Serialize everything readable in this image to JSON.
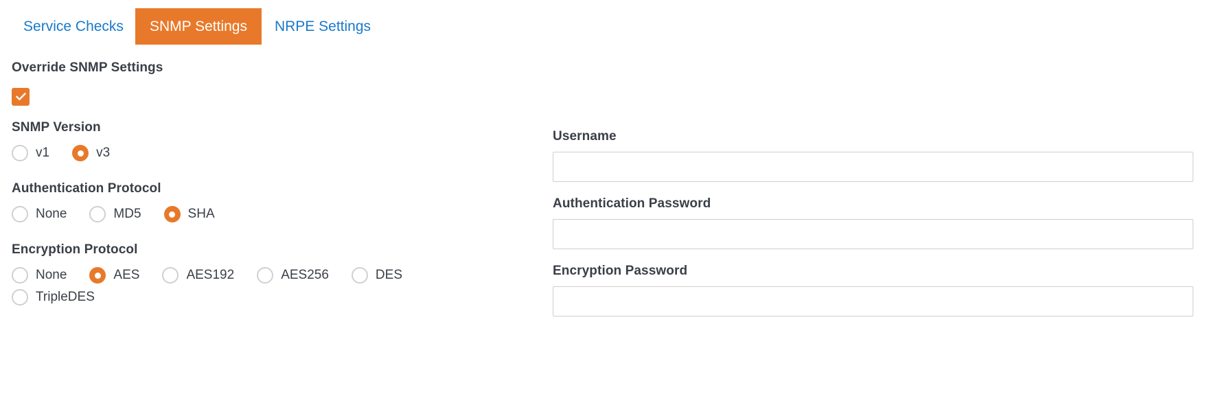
{
  "tabs": [
    {
      "label": "Service Checks",
      "active": false
    },
    {
      "label": "SNMP Settings",
      "active": true
    },
    {
      "label": "NRPE Settings",
      "active": false
    }
  ],
  "colors": {
    "accent": "#e8792a",
    "link": "#1979ca",
    "text": "#3a3f47",
    "input_border": "#cfcfcf",
    "radio_border": "#cfd0d2"
  },
  "left_column": {
    "override": {
      "label": "Override SNMP Settings",
      "checked": true,
      "icon": "check-icon"
    },
    "snmp_version": {
      "label": "SNMP Version",
      "options": [
        {
          "label": "v1",
          "selected": false
        },
        {
          "label": "v3",
          "selected": true
        }
      ],
      "selected": "v3"
    },
    "auth_protocol": {
      "label": "Authentication Protocol",
      "options": [
        {
          "label": "None",
          "selected": false
        },
        {
          "label": "MD5",
          "selected": false
        },
        {
          "label": "SHA",
          "selected": true
        }
      ],
      "selected": "SHA"
    },
    "encryption_protocol": {
      "label": "Encryption Protocol",
      "options": [
        {
          "label": "None",
          "selected": false
        },
        {
          "label": "AES",
          "selected": true
        },
        {
          "label": "AES192",
          "selected": false
        },
        {
          "label": "AES256",
          "selected": false
        },
        {
          "label": "DES",
          "selected": false
        },
        {
          "label": "TripleDES",
          "selected": false
        }
      ],
      "selected": "AES"
    }
  },
  "right_column": {
    "username": {
      "label": "Username",
      "value": "",
      "placeholder": ""
    },
    "auth_password": {
      "label": "Authentication Password",
      "value": "",
      "placeholder": ""
    },
    "encryption_password": {
      "label": "Encryption Password",
      "value": "",
      "placeholder": ""
    }
  }
}
